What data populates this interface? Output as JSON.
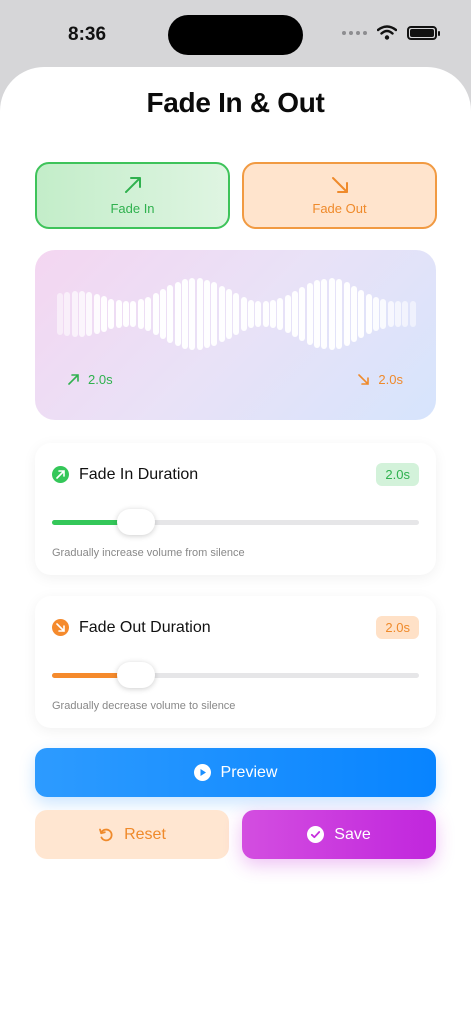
{
  "status_bar": {
    "time": "8:36"
  },
  "page": {
    "title": "Fade In & Out"
  },
  "modes": {
    "fade_in_label": "Fade In",
    "fade_out_label": "Fade Out"
  },
  "waveform": {
    "fade_in_time": "2.0s",
    "fade_out_time": "2.0s"
  },
  "fade_in": {
    "title": "Fade In Duration",
    "value_text": "2.0s",
    "slider_fraction": 0.23,
    "description": "Gradually increase volume from silence"
  },
  "fade_out": {
    "title": "Fade Out Duration",
    "value_text": "2.0s",
    "slider_fraction": 0.23,
    "description": "Gradually decrease volume to silence"
  },
  "actions": {
    "preview_label": "Preview",
    "reset_label": "Reset",
    "save_label": "Save"
  },
  "colors": {
    "fade_in_accent": "#34c759",
    "fade_out_accent": "#f58a2c",
    "preview_blue": "#0a84ff",
    "save_purple": "#c62fdd"
  },
  "icons": {
    "fade_in": "arrow-up-right-icon",
    "fade_out": "arrow-down-right-icon",
    "preview": "play-circle-icon",
    "reset": "counterclockwise-arrow-icon",
    "save": "checkmark-circle-icon"
  }
}
